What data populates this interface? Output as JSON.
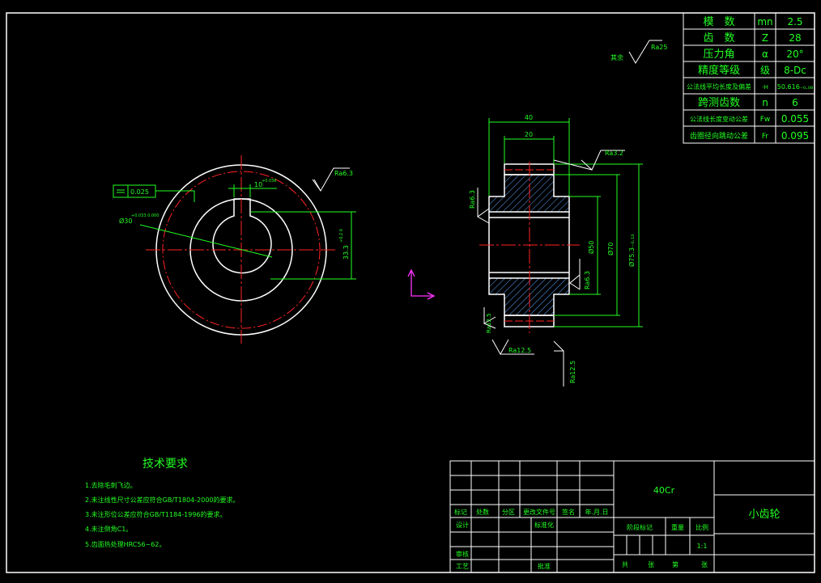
{
  "params": [
    {
      "label": "模　数",
      "sym": "mn",
      "val": "2.5"
    },
    {
      "label": "齿　数",
      "sym": "Z",
      "val": "28"
    },
    {
      "label": "压力角",
      "sym": "α",
      "val": "20°"
    },
    {
      "label": "精度等级",
      "sym": "级",
      "val": "8-Dc"
    },
    {
      "label": "公法线平均长度及偏差",
      "sym": "-H",
      "val": "50.616₋₀.₀₈"
    },
    {
      "label": "跨测齿数",
      "sym": "n",
      "val": "6"
    },
    {
      "label": "公法线长度变动公差",
      "sym": "Fw",
      "val": "0.055"
    },
    {
      "label": "齿圈径向跳动公差",
      "sym": "Fr",
      "val": "0.095"
    }
  ],
  "roughness": {
    "rest": "其余",
    "rest_val": "Ra25",
    "front_outer": "Ra6.3",
    "side_top": "Ra3.2",
    "side_left": "Ra6.3",
    "side_bore": "Ra6.3",
    "side_bl1": "Ra12.5",
    "side_bl2": "Ra12.5",
    "side_br": "Ra12.5"
  },
  "front_view": {
    "tolerance": "0.025",
    "keyway_width": "10",
    "keyway_width_tol": "+0.036",
    "bore_dia": "Ø30",
    "bore_tol": "+0.033 0.000",
    "key_depth": "33.3",
    "key_depth_tol": "+0.2 0"
  },
  "side_view": {
    "width_total": "40",
    "width_hub": "20",
    "dia_hub": "Ø50",
    "dia_root": "Ø70",
    "dia_tip": "Ø75.3₋₀.₁₃"
  },
  "tech": {
    "title": "技术要求",
    "items": [
      "1.去除毛刺飞边。",
      "2.未注线性尺寸公差应符合GB/T1804-2000的要求。",
      "3.未注形位公差应符合GB/T1184-1996的要求。",
      "4.未注倒角C1。",
      "5.齿面热处理HRC56~62。"
    ]
  },
  "title_block": {
    "material": "40Cr",
    "part_name": "小齿轮",
    "h_biaoji": "标记",
    "h_chushu": "处数",
    "h_fenqu": "分区",
    "h_wenjian": "更改文件号",
    "h_qianming": "签名",
    "h_date": "年.月.日",
    "design": "设计",
    "standard": "标准化",
    "stage": "阶段标记",
    "weight": "重量",
    "scale_label": "比例",
    "scale": "1:1",
    "review": "审核",
    "process": "工艺",
    "approve": "批准",
    "total": "共",
    "sheets": "张",
    "no": "第",
    "sheet2": "张"
  }
}
